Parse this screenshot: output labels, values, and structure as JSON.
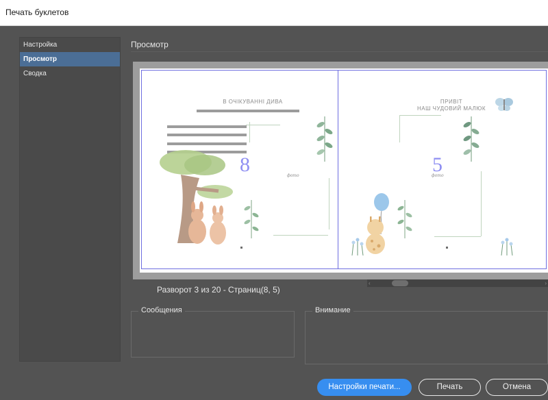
{
  "window": {
    "title": "Печать буклетов"
  },
  "sidebar": {
    "items": [
      {
        "label": "Настройка",
        "selected": false
      },
      {
        "label": "Просмотр",
        "selected": true
      },
      {
        "label": "Сводка",
        "selected": false
      }
    ]
  },
  "section": {
    "title": "Просмотр"
  },
  "preview": {
    "left_page": {
      "title": "В ОЧІКУВАННІ ДИВА",
      "number": "8",
      "photo_label": "фото"
    },
    "right_page": {
      "title_line1": "ПРИВІТ",
      "title_line2": "НАШ ЧУДОВИЙ МАЛЮК",
      "number": "5",
      "photo_label": "фото"
    },
    "scroll_position": 0.12
  },
  "spread_info": "Разворот 3 из 20 - Страниц(8, 5)",
  "messages": {
    "label": "Сообщения"
  },
  "attention": {
    "label": "Внимание"
  },
  "buttons": {
    "print_settings": "Настройки печати...",
    "print": "Печать",
    "cancel": "Отмена"
  },
  "colors": {
    "accent": "#378ef0",
    "selection": "#4b6e96",
    "guide": "#6d6de0",
    "page_number": "#8f8ff2"
  },
  "icons": [
    "tree-illustration",
    "kangaroo-illustration",
    "giraffe-illustration",
    "balloon-illustration",
    "butterfly-illustration",
    "leaf-illustration",
    "flower-illustration"
  ]
}
